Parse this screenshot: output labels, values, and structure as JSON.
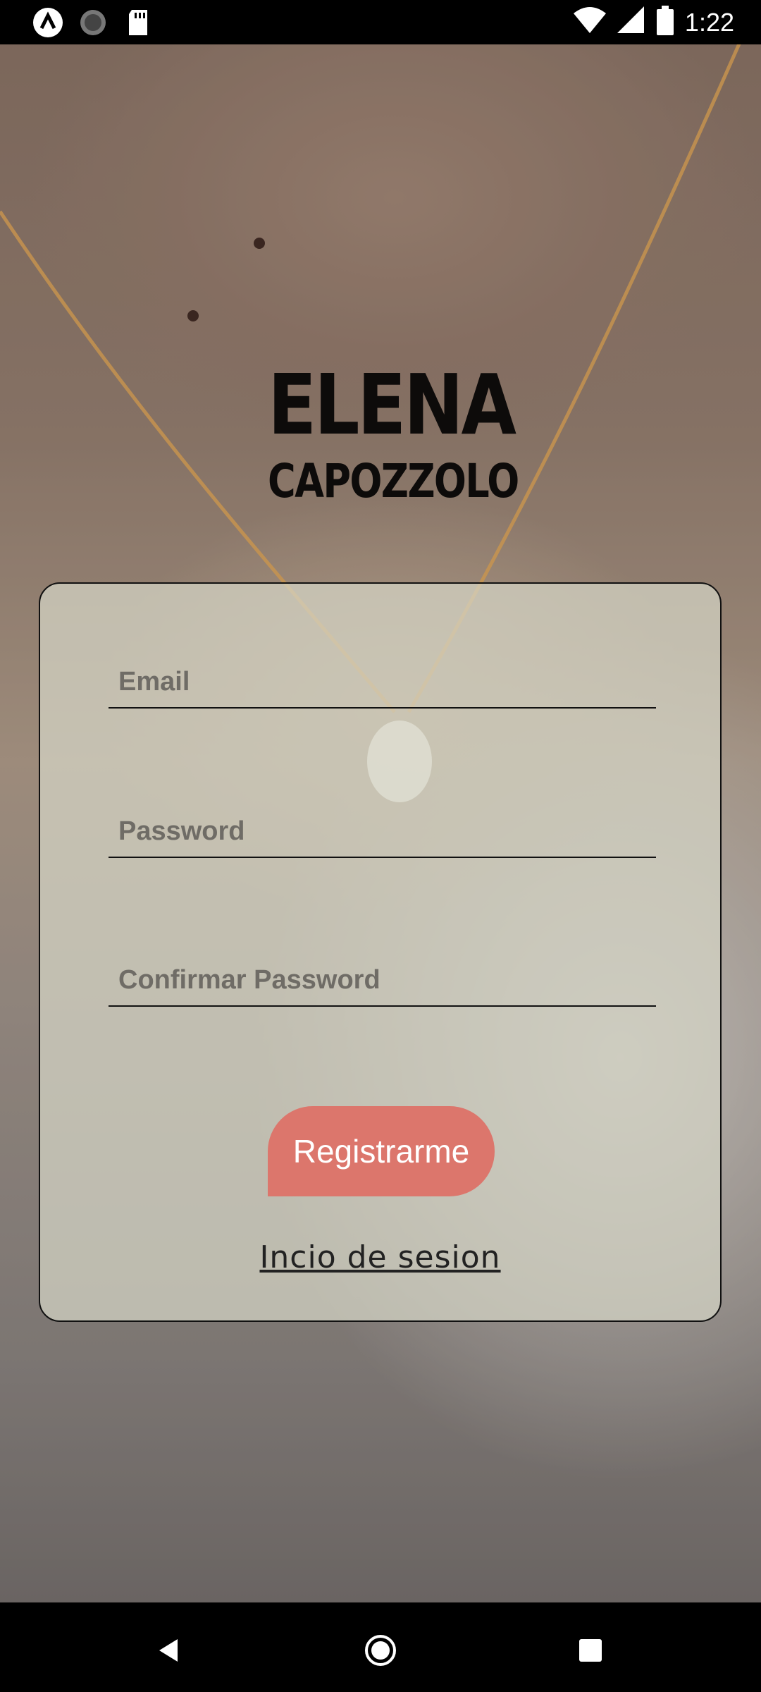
{
  "status_bar": {
    "time": "1:22",
    "left_icons": [
      "app-notification-icon",
      "loading-icon",
      "sd-card-icon"
    ],
    "right_icons": [
      "wifi-icon",
      "signal-icon",
      "battery-icon"
    ]
  },
  "brand": {
    "line1": "ELENA",
    "line2": "CAPOZZOLO"
  },
  "form": {
    "email_placeholder": "Email",
    "password_placeholder": "Password",
    "confirm_placeholder": "Confirmar Password",
    "register_label": "Registrarme",
    "login_link": "Incio de sesion"
  },
  "colors": {
    "button": "#dc766c",
    "card": "#d6d6c6"
  },
  "nav_bar": {
    "buttons": [
      "back-icon",
      "home-icon",
      "recent-apps-icon"
    ]
  }
}
